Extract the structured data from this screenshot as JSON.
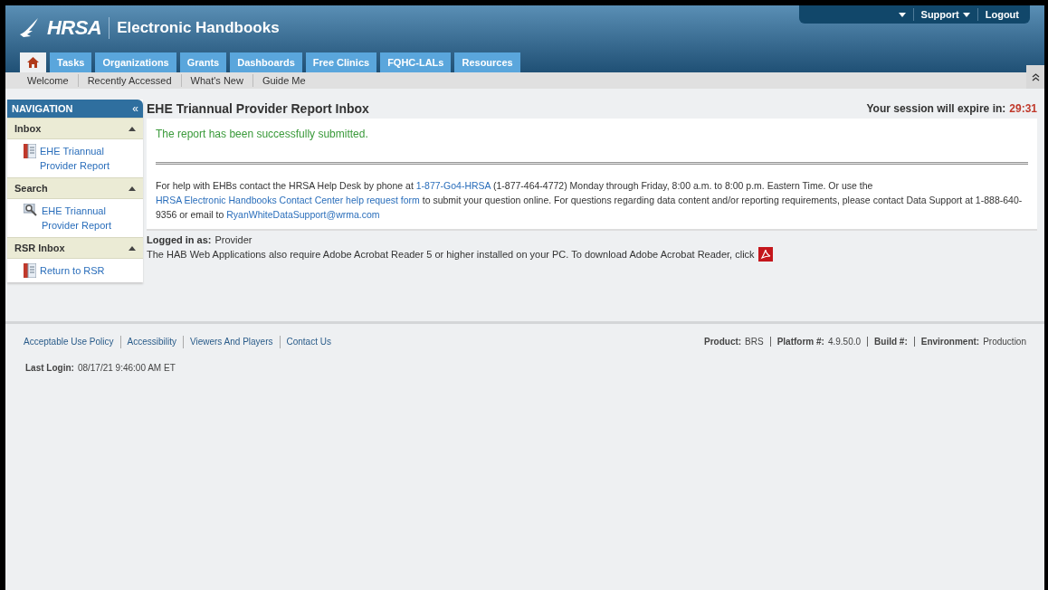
{
  "header": {
    "logo": "HRSA",
    "title": "Electronic Handbooks",
    "top_links": [
      {
        "kind": "menu"
      },
      {
        "label": "Support",
        "kind": "menu"
      },
      {
        "label": "Logout",
        "kind": "link"
      }
    ]
  },
  "tabs": [
    {
      "kind": "home",
      "selected": true
    },
    {
      "label": "Tasks",
      "kind": "text",
      "selected": false
    },
    {
      "label": "Organizations",
      "kind": "text",
      "selected": false
    },
    {
      "label": "Grants",
      "kind": "text",
      "selected": false
    },
    {
      "label": "Dashboards",
      "kind": "text",
      "selected": false
    },
    {
      "label": "Free Clinics",
      "kind": "text",
      "selected": false
    },
    {
      "label": "FQHC-LALs",
      "kind": "text",
      "selected": false
    },
    {
      "label": "Resources",
      "kind": "text",
      "selected": false
    }
  ],
  "subnav": [
    "Welcome",
    "Recently Accessed",
    "What's New",
    "Guide Me"
  ],
  "navigation": {
    "title": "NAVIGATION",
    "collapse": "«",
    "sections": [
      {
        "title": "Inbox",
        "expanded": true,
        "items": [
          {
            "label": "EHE Triannual Provider Report",
            "kind": "report"
          }
        ]
      },
      {
        "title": "Search",
        "expanded": true,
        "items": [
          {
            "label": "EHE Triannual Provider Report",
            "kind": "search"
          }
        ]
      },
      {
        "title": "RSR Inbox",
        "expanded": true,
        "items": [
          {
            "label": "Return to RSR",
            "kind": "report"
          }
        ]
      }
    ]
  },
  "page": {
    "title": "EHE Triannual Provider Report Inbox",
    "session_label": "Your session will expire in:",
    "session_time": "29:31",
    "message": "The report has been successfully submitted.",
    "help": [
      {
        "kind": "text",
        "text": "For help with EHBs contact the HRSA Help Desk by phone at "
      },
      {
        "kind": "link",
        "text": "1-877-Go4-HRSA"
      },
      {
        "kind": "text",
        "text": " (1-877-464-4772) Monday through Friday, 8:00 a.m. to 8:00 p.m. Eastern Time. Or use the "
      },
      {
        "kind": "link",
        "text": "HRSA Electronic Handbooks"
      },
      {
        "kind": "link",
        "text": "Contact Center help request form"
      },
      {
        "kind": "text",
        "text": " to submit your question online. For questions regarding data content and/or reporting requirements, please contact Data Support at 1-888-640-9356 or email to "
      },
      {
        "kind": "link",
        "text": "RyanWhiteDataSupport@wrma.com"
      }
    ],
    "logged_in_label": "Logged in as:",
    "logged_in_value": "Provider",
    "acrobat_text": "The HAB Web Applications also require Adobe Acrobat Reader 5 or higher installed on your PC. To download Adobe Acrobat Reader, click"
  },
  "footer": {
    "links": [
      "Acceptable Use Policy",
      "Accessibility",
      "Viewers And Players",
      "Contact Us"
    ],
    "last_login_label": "Last Login:",
    "last_login_value": "08/17/21 9:46:00 AM ET",
    "info": [
      {
        "label": "Product:",
        "value": "BRS"
      },
      {
        "label": "Platform #:",
        "value": "4.9.50.0"
      },
      {
        "label": "Build #:"
      },
      {
        "label": "Environment:",
        "value": "Production"
      }
    ]
  }
}
